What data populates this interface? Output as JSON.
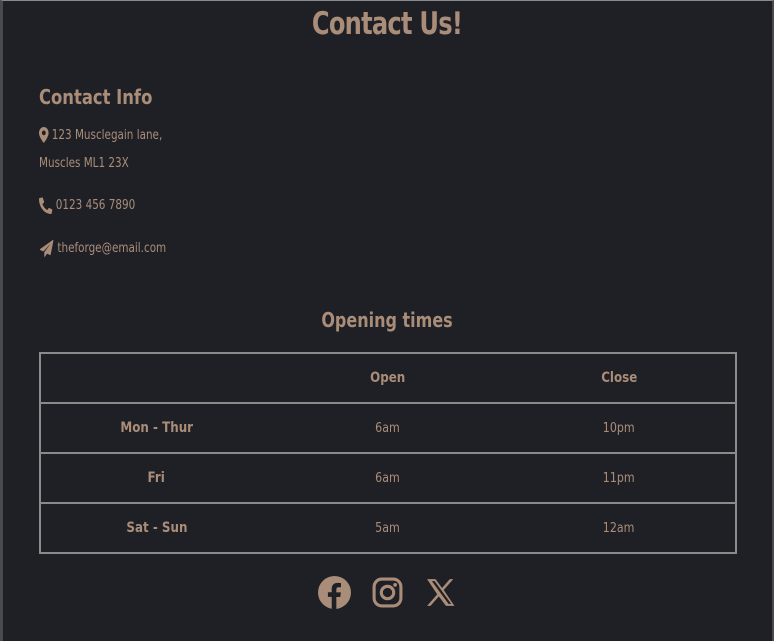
{
  "page": {
    "title": "Contact Us!"
  },
  "contact": {
    "heading": "Contact Info",
    "address_line1": "123 Musclegain lane,",
    "address_line2": "Muscles ML1 23X",
    "phone": "0123 456 7890",
    "email": "theforge@email.com"
  },
  "hours": {
    "heading": "Opening times",
    "columns": [
      "",
      "Open",
      "Close"
    ],
    "rows": [
      {
        "day": "Mon - Thur",
        "open": "6am",
        "close": "10pm"
      },
      {
        "day": "Fri",
        "open": "6am",
        "close": "11pm"
      },
      {
        "day": "Sat - Sun",
        "open": "5am",
        "close": "12am"
      }
    ]
  },
  "socials": [
    {
      "icon": "facebook-icon"
    },
    {
      "icon": "instagram-icon"
    },
    {
      "icon": "x-twitter-icon"
    }
  ],
  "colors": {
    "background": "#1f2026",
    "accent": "#a98d78",
    "table_border": "#8a8a8a"
  }
}
